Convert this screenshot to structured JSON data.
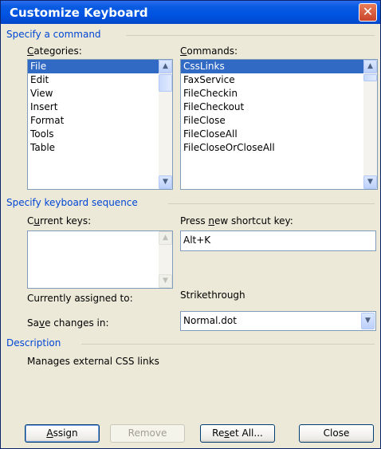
{
  "window": {
    "title": "Customize Keyboard",
    "close_glyph": "✕"
  },
  "specify_command": {
    "heading": "Specify a command",
    "categories_label": "ategories:",
    "categories_mnemonic": "C",
    "commands_label": "ommands:",
    "commands_mnemonic": "C",
    "categories": [
      "File",
      "Edit",
      "View",
      "Insert",
      "Format",
      "Tools",
      "Table"
    ],
    "commands": [
      "CssLinks",
      "FaxService",
      "FileCheckin",
      "FileCheckout",
      "FileClose",
      "FileCloseAll",
      "FileCloseOrCloseAll"
    ]
  },
  "keyboard_sequence": {
    "heading": "Specify keyboard sequence",
    "current_keys_label_pre": "C",
    "current_keys_mnemonic": "u",
    "current_keys_label_post": "rrent keys:",
    "new_key_label_pre": "Press ",
    "new_key_mnemonic": "n",
    "new_key_label_post": "ew shortcut key:",
    "new_key_value": "Alt+K",
    "assigned_label": "Currently assigned to:",
    "assigned_value": "Strikethrough",
    "save_label_pre": "Sa",
    "save_mnemonic": "v",
    "save_label_post": "e changes in:",
    "save_value": "Normal.dot"
  },
  "description": {
    "heading": "Description",
    "text": "Manages external CSS links"
  },
  "buttons": {
    "assign_mnemonic": "A",
    "assign_rest": "ssign",
    "remove": "Remove",
    "reset_pre": "Re",
    "reset_mnemonic": "s",
    "reset_post": "et All...",
    "close": "Close"
  },
  "icons": {
    "scroll_up": "▲",
    "scroll_down": "▼",
    "dropdown": "▼"
  }
}
